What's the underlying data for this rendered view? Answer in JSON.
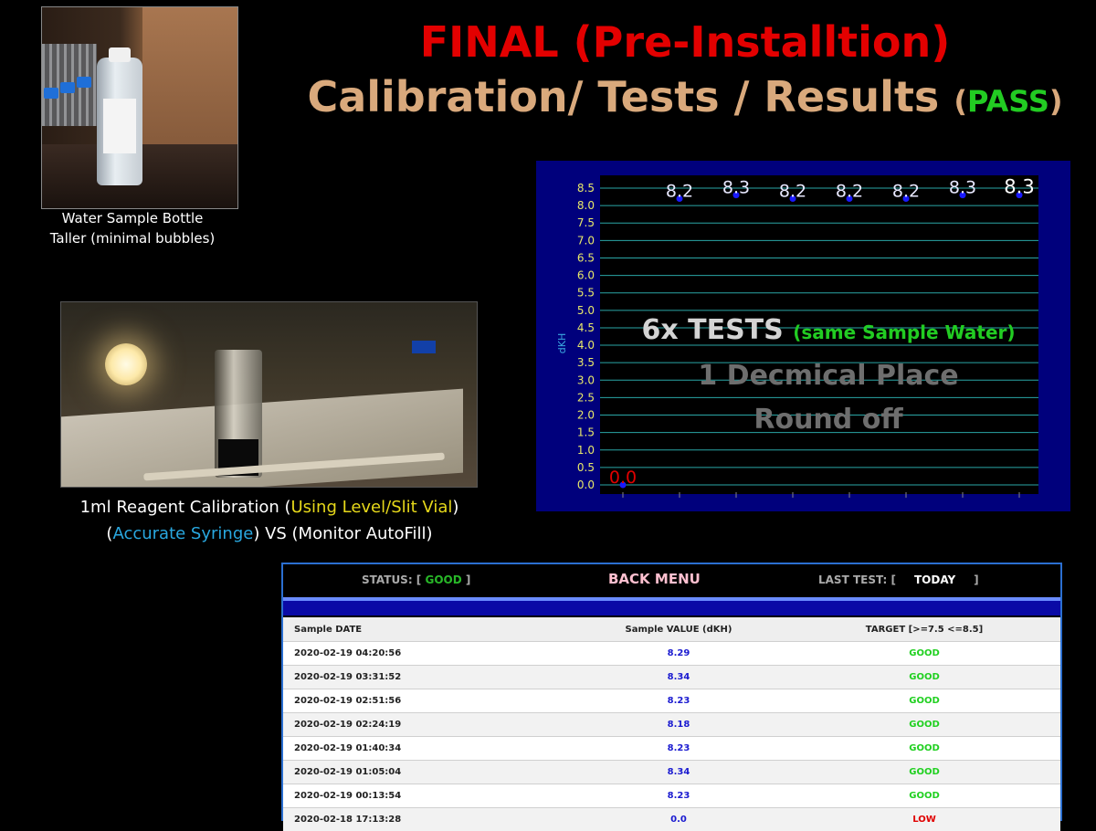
{
  "title": {
    "line1": "FINAL (Pre-Installtion)",
    "line2": "Calibration/ Tests / Results",
    "pass_open": "(",
    "pass": "PASS",
    "pass_close": ")"
  },
  "photo1": {
    "caption_line1": "Water Sample Bottle",
    "caption_line2": "Taller (minimal bubbles)"
  },
  "photo2": {
    "caption_a": "1ml Reagent Calibration (",
    "caption_b": "Using Level/Slit Vial",
    "caption_c": ")",
    "caption_d": "(",
    "caption_e": "Accurate Syringe",
    "caption_f": ") VS (Monitor AutoFill)"
  },
  "overlay": {
    "line1_a": "6x TESTS",
    "line1_b": "(same Sample Water)",
    "line2": "1 Decmical Place",
    "line3": "Round off"
  },
  "colors": {
    "title_red": "#e30000",
    "title_tan": "#d9a97c",
    "pass_green": "#22cc22",
    "chart_frame": "#00007c",
    "chart_grid": "#2aa6a6",
    "point_blue": "#1a1aff",
    "zero_label": "#e00000"
  },
  "chart_data": {
    "type": "scatter",
    "ylabel": "dKH",
    "ylim": [
      0,
      8.5
    ],
    "yticks": [
      "0.0",
      "0.5",
      "1.0",
      "1.5",
      "2.0",
      "2.5",
      "3.0",
      "3.5",
      "4.0",
      "4.5",
      "5.0",
      "5.5",
      "6.0",
      "6.5",
      "7.0",
      "7.5",
      "8.0",
      "8.5"
    ],
    "x": [
      1,
      2,
      3,
      4,
      5,
      6,
      7,
      8
    ],
    "values": [
      0.0,
      8.2,
      8.3,
      8.2,
      8.2,
      8.2,
      8.3,
      8.3
    ],
    "labels": [
      "0.0",
      "8.2",
      "8.3",
      "8.2",
      "8.2",
      "8.2",
      "8.3",
      "8.3"
    ]
  },
  "table": {
    "status_prefix": "STATUS: [ ",
    "status_value": "GOOD",
    "status_suffix": " ]",
    "back_menu": "BACK MENU",
    "last_prefix": "LAST TEST: [",
    "last_value": "TODAY",
    "last_suffix": "]",
    "headers": [
      "Sample DATE",
      "Sample VALUE (dKH)",
      "TARGET [>=7.5 <=8.5]"
    ],
    "rows": [
      {
        "date": "2020-02-19 04:20:56",
        "value": "8.29",
        "target": "GOOD"
      },
      {
        "date": "2020-02-19 03:31:52",
        "value": "8.34",
        "target": "GOOD"
      },
      {
        "date": "2020-02-19 02:51:56",
        "value": "8.23",
        "target": "GOOD"
      },
      {
        "date": "2020-02-19 02:24:19",
        "value": "8.18",
        "target": "GOOD"
      },
      {
        "date": "2020-02-19 01:40:34",
        "value": "8.23",
        "target": "GOOD"
      },
      {
        "date": "2020-02-19 01:05:04",
        "value": "8.34",
        "target": "GOOD"
      },
      {
        "date": "2020-02-19 00:13:54",
        "value": "8.23",
        "target": "GOOD"
      },
      {
        "date": "2020-02-18 17:13:28",
        "value": "0.0",
        "target": "LOW"
      }
    ]
  }
}
